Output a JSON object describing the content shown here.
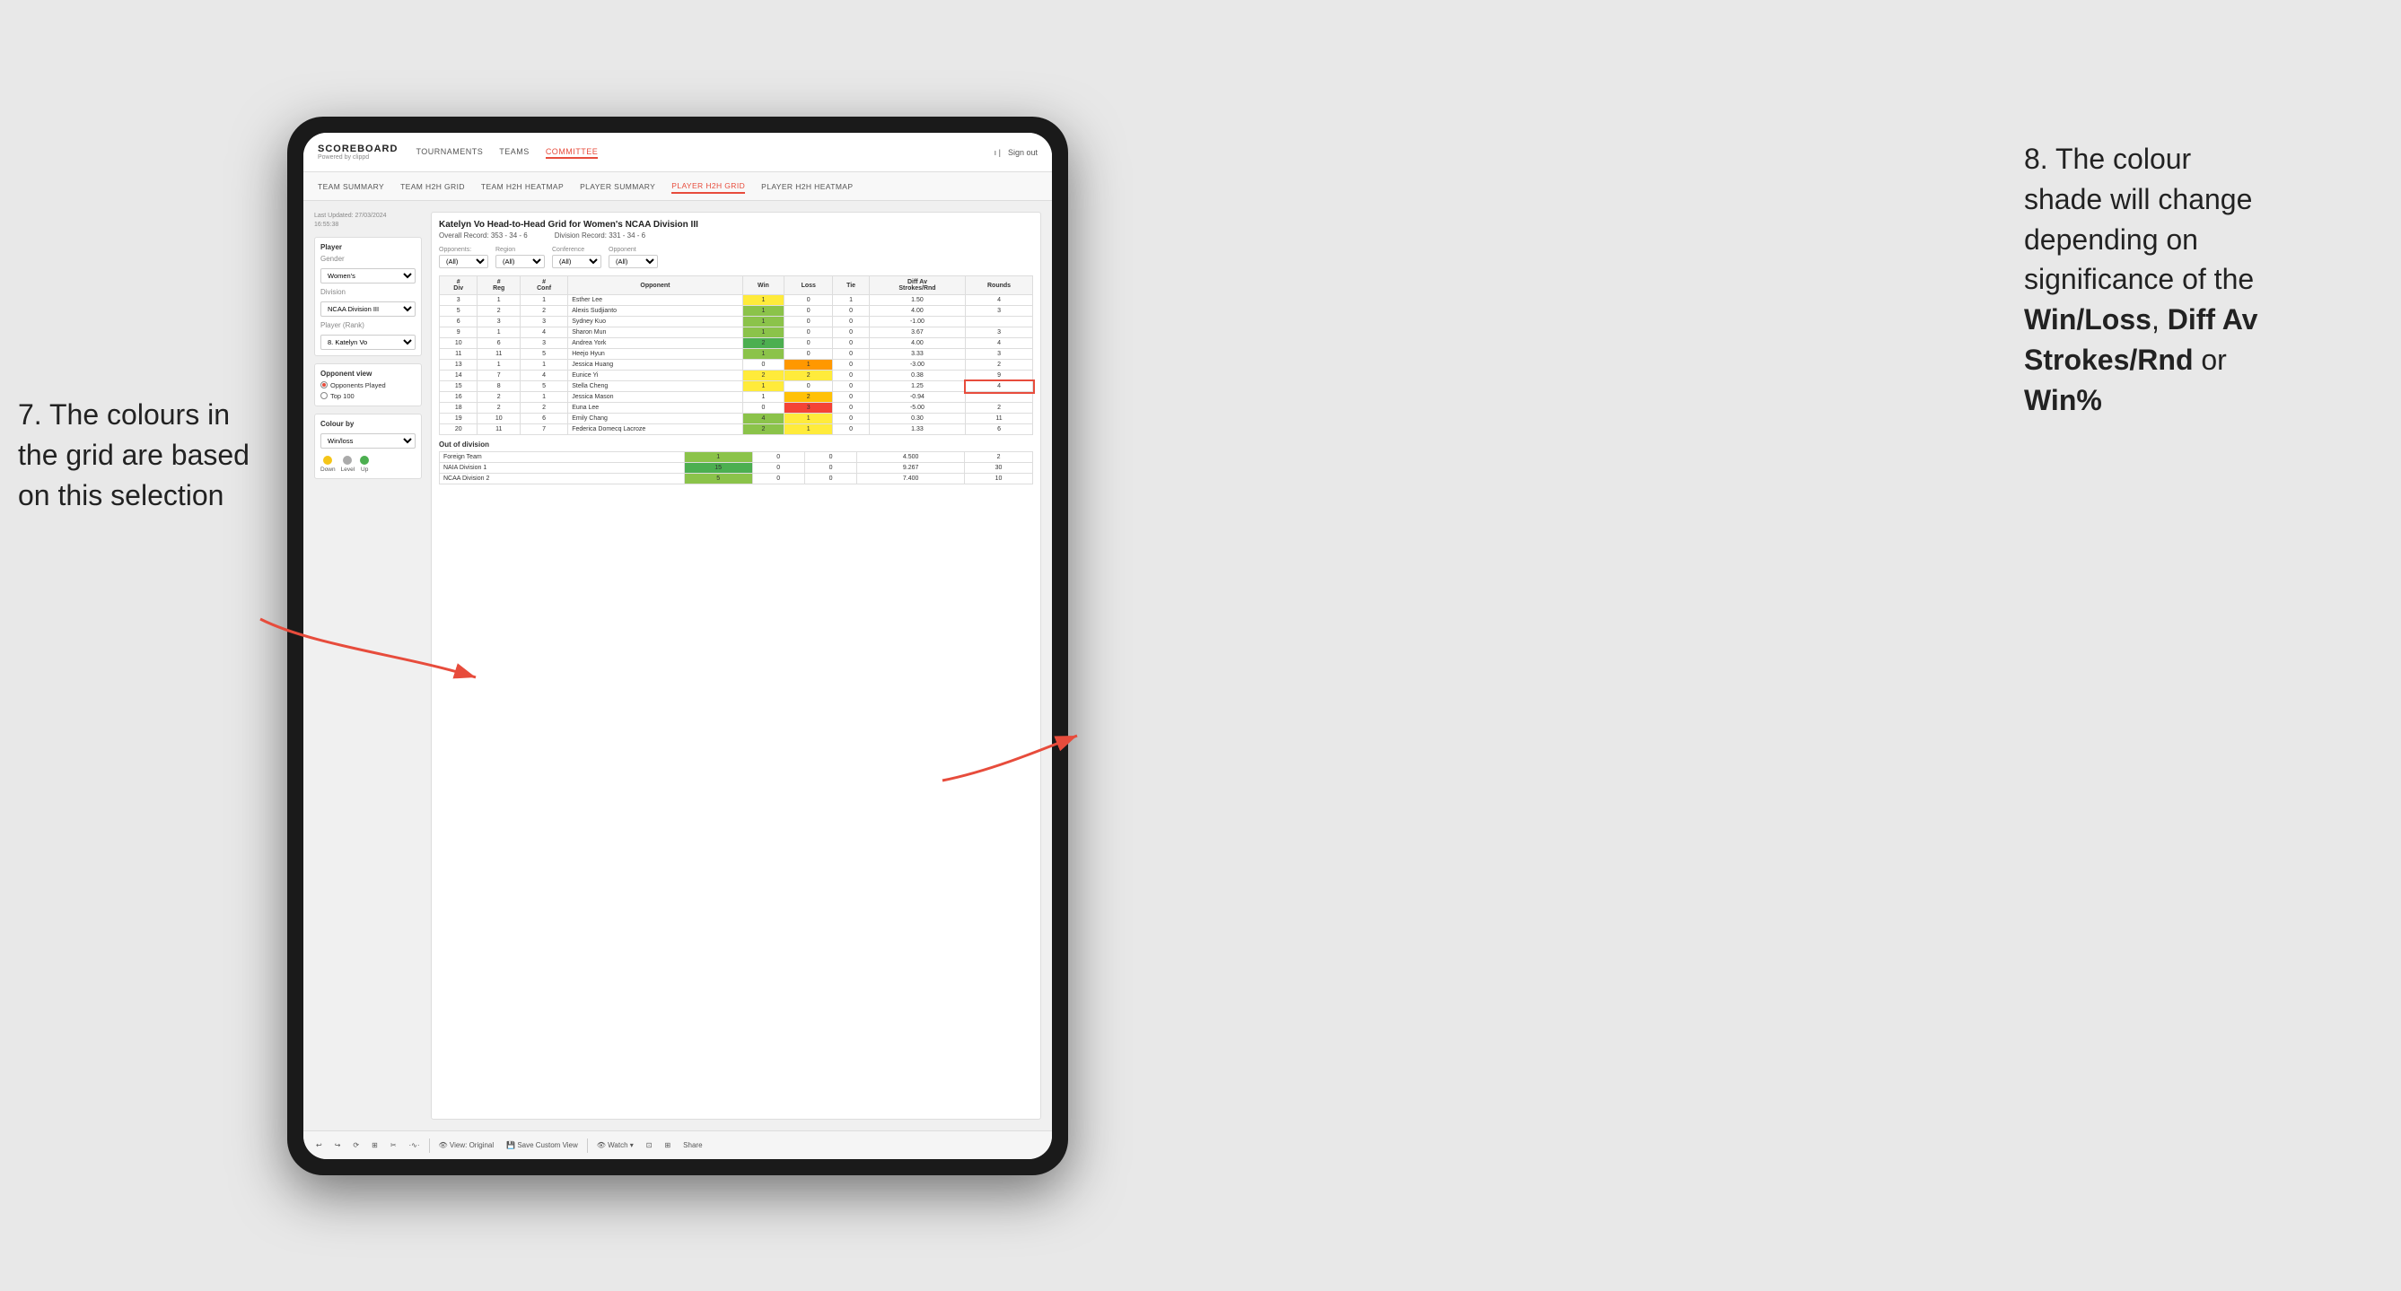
{
  "annotations": {
    "left_text_line1": "7. The colours in",
    "left_text_line2": "the grid are based",
    "left_text_line3": "on this selection",
    "right_text_line1": "8. The colour",
    "right_text_line2": "shade will change",
    "right_text_line3": "depending on",
    "right_text_line4": "significance of the",
    "right_text_bold1": "Win/Loss",
    "right_text_comma": ", ",
    "right_text_bold2": "Diff Av",
    "right_text_line5": "Strokes/Rnd",
    "right_text_or": " or",
    "right_text_bold3": "Win%"
  },
  "nav": {
    "logo_title": "SCOREBOARD",
    "logo_sub": "Powered by clippd",
    "items": [
      "TOURNAMENTS",
      "TEAMS",
      "COMMITTEE"
    ],
    "active_item": "COMMITTEE",
    "sign_in_label": "Sign out"
  },
  "sub_nav": {
    "items": [
      "TEAM SUMMARY",
      "TEAM H2H GRID",
      "TEAM H2H HEATMAP",
      "PLAYER SUMMARY",
      "PLAYER H2H GRID",
      "PLAYER H2H HEATMAP"
    ],
    "active": "PLAYER H2H GRID"
  },
  "left_panel": {
    "last_updated_label": "Last Updated: 27/03/2024",
    "last_updated_time": "16:55:38",
    "player_label": "Player",
    "gender_label": "Gender",
    "gender_value": "Women's",
    "division_label": "Division",
    "division_value": "NCAA Division III",
    "player_rank_label": "Player (Rank)",
    "player_rank_value": "8. Katelyn Vo",
    "opponent_view_label": "Opponent view",
    "opponent_played_label": "Opponents Played",
    "top100_label": "Top 100",
    "colour_by_label": "Colour by",
    "colour_by_value": "Win/loss",
    "legend": {
      "down_label": "Down",
      "level_label": "Level",
      "up_label": "Up",
      "down_color": "#f5c518",
      "level_color": "#aaaaaa",
      "up_color": "#4caf50"
    }
  },
  "grid": {
    "title": "Katelyn Vo Head-to-Head Grid for Women's NCAA Division III",
    "overall_record_label": "Overall Record:",
    "overall_record_value": "353 - 34 - 6",
    "division_record_label": "Division Record:",
    "division_record_value": "331 - 34 - 6",
    "filters": {
      "opponents_label": "Opponents:",
      "opponents_value": "(All)",
      "region_label": "Region",
      "region_value": "(All)",
      "conference_label": "Conference",
      "conference_value": "(All)",
      "opponent_label": "Opponent",
      "opponent_value": "(All)"
    },
    "column_headers": [
      "#\nDiv",
      "#\nReg",
      "#\nConf",
      "Opponent",
      "Win",
      "Loss",
      "Tie",
      "Diff Av\nStrokes/Rnd",
      "Rounds"
    ],
    "rows": [
      {
        "div": "3",
        "reg": "1",
        "conf": "1",
        "opponent": "Esther Lee",
        "win": 1,
        "loss": 0,
        "tie": 1,
        "diff": "1.50",
        "rounds": 4,
        "win_color": "yellow",
        "loss_color": "white"
      },
      {
        "div": "5",
        "reg": "2",
        "conf": "2",
        "opponent": "Alexis Sudjianto",
        "win": 1,
        "loss": 0,
        "tie": 0,
        "diff": "4.00",
        "rounds": 3,
        "win_color": "green",
        "loss_color": "white"
      },
      {
        "div": "6",
        "reg": "3",
        "conf": "3",
        "opponent": "Sydney Kuo",
        "win": 1,
        "loss": 0,
        "tie": 0,
        "diff": "-1.00",
        "rounds": "",
        "win_color": "green",
        "loss_color": "white"
      },
      {
        "div": "9",
        "reg": "1",
        "conf": "4",
        "opponent": "Sharon Mun",
        "win": 1,
        "loss": 0,
        "tie": 0,
        "diff": "3.67",
        "rounds": 3,
        "win_color": "green",
        "loss_color": "white"
      },
      {
        "div": "10",
        "reg": "6",
        "conf": "3",
        "opponent": "Andrea York",
        "win": 2,
        "loss": 0,
        "tie": 0,
        "diff": "4.00",
        "rounds": 4,
        "win_color": "green-dark",
        "loss_color": "white"
      },
      {
        "div": "11",
        "reg": "11",
        "conf": "5",
        "opponent": "Heejo Hyun",
        "win": 1,
        "loss": 0,
        "tie": 0,
        "diff": "3.33",
        "rounds": 3,
        "win_color": "green",
        "loss_color": "white"
      },
      {
        "div": "13",
        "reg": "1",
        "conf": "1",
        "opponent": "Jessica Huang",
        "win": 0,
        "loss": 1,
        "tie": 0,
        "diff": "-3.00",
        "rounds": 2,
        "win_color": "white",
        "loss_color": "orange"
      },
      {
        "div": "14",
        "reg": "7",
        "conf": "4",
        "opponent": "Eunice Yi",
        "win": 2,
        "loss": 2,
        "tie": 0,
        "diff": "0.38",
        "rounds": 9,
        "win_color": "yellow",
        "loss_color": "yellow"
      },
      {
        "div": "15",
        "reg": "8",
        "conf": "5",
        "opponent": "Stella Cheng",
        "win": 1,
        "loss": 0,
        "tie": 0,
        "diff": "1.25",
        "rounds": 4,
        "win_color": "yellow",
        "loss_color": "white"
      },
      {
        "div": "16",
        "reg": "2",
        "conf": "1",
        "opponent": "Jessica Mason",
        "win": 1,
        "loss": 2,
        "tie": 0,
        "diff": "-0.94",
        "rounds": "",
        "win_color": "white",
        "loss_color": "light-orange"
      },
      {
        "div": "18",
        "reg": "2",
        "conf": "2",
        "opponent": "Euna Lee",
        "win": 0,
        "loss": 3,
        "tie": 0,
        "diff": "-5.00",
        "rounds": 2,
        "win_color": "white",
        "loss_color": "red"
      },
      {
        "div": "19",
        "reg": "10",
        "conf": "6",
        "opponent": "Emily Chang",
        "win": 4,
        "loss": 1,
        "tie": 0,
        "diff": "0.30",
        "rounds": 11,
        "win_color": "green",
        "loss_color": "yellow"
      },
      {
        "div": "20",
        "reg": "11",
        "conf": "7",
        "opponent": "Federica Domecq Lacroze",
        "win": 2,
        "loss": 1,
        "tie": 0,
        "diff": "1.33",
        "rounds": 6,
        "win_color": "green",
        "loss_color": "yellow"
      }
    ],
    "out_of_division_label": "Out of division",
    "out_of_division_rows": [
      {
        "group": "Foreign Team",
        "win": 1,
        "loss": 0,
        "tie": 0,
        "diff": "4.500",
        "rounds": 2,
        "win_color": "green"
      },
      {
        "group": "NAIA Division 1",
        "win": 15,
        "loss": 0,
        "tie": 0,
        "diff": "9.267",
        "rounds": 30,
        "win_color": "green-dark"
      },
      {
        "group": "NCAA Division 2",
        "win": 5,
        "loss": 0,
        "tie": 0,
        "diff": "7.400",
        "rounds": 10,
        "win_color": "green"
      }
    ]
  },
  "toolbar": {
    "buttons": [
      "↩",
      "↪",
      "⟳",
      "⊞",
      "✂",
      "⌘",
      "·",
      "View: Original",
      "Save Custom View",
      "Watch ▾",
      "⊡",
      "⊞",
      "Share"
    ]
  }
}
